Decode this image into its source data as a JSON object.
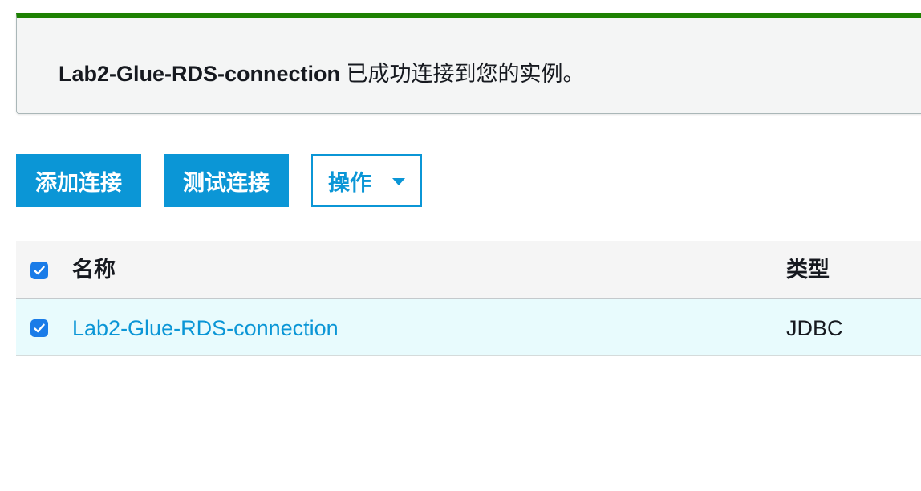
{
  "flash": {
    "type": "success",
    "connection_name": "Lab2-Glue-RDS-connection",
    "message": " 已成功连接到您的实例。",
    "accent_color": "#1d8102"
  },
  "toolbar": {
    "add_label": "添加连接",
    "test_label": "测试连接",
    "actions_label": "操作",
    "actions_icon": "caret-down-icon",
    "primary_color": "#0b96d6"
  },
  "table": {
    "select_all_checked": true,
    "columns": [
      "名称",
      "类型"
    ],
    "rows": [
      {
        "checked": true,
        "name": "Lab2-Glue-RDS-connection",
        "type": "JDBC"
      }
    ],
    "selected_row_color": "#e8fbfd",
    "checkbox_color": "#1a7ce8"
  }
}
